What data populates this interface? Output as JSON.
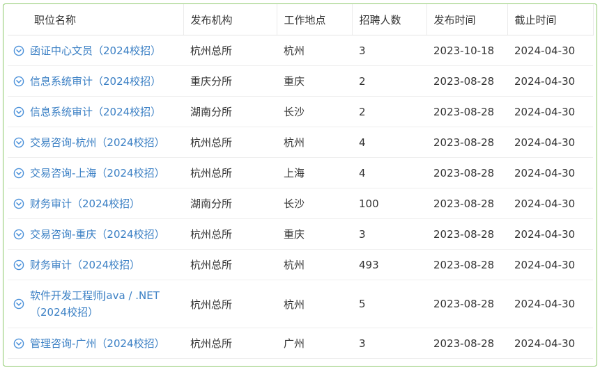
{
  "table": {
    "headers": [
      "职位名称",
      "发布机构",
      "工作地点",
      "招聘人数",
      "发布时间",
      "截止时间"
    ],
    "rows": [
      {
        "title": "函证中心文员（2024校招）",
        "org": "杭州总所",
        "location": "杭州",
        "count": "3",
        "published": "2023-10-18",
        "deadline": "2024-04-30"
      },
      {
        "title": "信息系统审计（2024校招）",
        "org": "重庆分所",
        "location": "重庆",
        "count": "2",
        "published": "2023-08-28",
        "deadline": "2024-04-30"
      },
      {
        "title": "信息系统审计（2024校招）",
        "org": "湖南分所",
        "location": "长沙",
        "count": "2",
        "published": "2023-08-28",
        "deadline": "2024-04-30"
      },
      {
        "title": "交易咨询-杭州（2024校招）",
        "org": "杭州总所",
        "location": "杭州",
        "count": "4",
        "published": "2023-08-28",
        "deadline": "2024-04-30"
      },
      {
        "title": "交易咨询-上海（2024校招）",
        "org": "杭州总所",
        "location": "上海",
        "count": "4",
        "published": "2023-08-28",
        "deadline": "2024-04-30"
      },
      {
        "title": "财务审计（2024校招）",
        "org": "湖南分所",
        "location": "长沙",
        "count": "100",
        "published": "2023-08-28",
        "deadline": "2024-04-30"
      },
      {
        "title": "交易咨询-重庆（2024校招）",
        "org": "杭州总所",
        "location": "重庆",
        "count": "3",
        "published": "2023-08-28",
        "deadline": "2024-04-30"
      },
      {
        "title": "财务审计（2024校招）",
        "org": "杭州总所",
        "location": "杭州",
        "count": "493",
        "published": "2023-08-28",
        "deadline": "2024-04-30"
      },
      {
        "title": "软件开发工程师Java / .NET（2024校招）",
        "org": "杭州总所",
        "location": "杭州",
        "count": "5",
        "published": "2023-08-28",
        "deadline": "2024-04-30"
      },
      {
        "title": "管理咨询-广州（2024校招）",
        "org": "杭州总所",
        "location": "广州",
        "count": "3",
        "published": "2023-08-28",
        "deadline": "2024-04-30"
      }
    ]
  },
  "icons": {
    "expand": "chevron-down-circle-icon"
  },
  "colors": {
    "link": "#3a7fc4",
    "border": "#8cc96b",
    "icon": "#4a90d9"
  }
}
